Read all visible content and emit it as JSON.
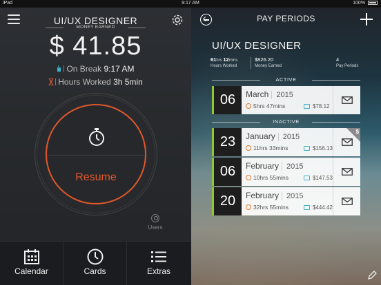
{
  "status_bar": {
    "device": "iPad",
    "time": "9:17 AM",
    "battery": "100%"
  },
  "left": {
    "job_title": "UI/UX DESIGNER",
    "earned_label": "MONEY EARNED",
    "earned_amount": "$ 41.85",
    "break_label": "On Break",
    "break_time": "9:17 AM",
    "hours_label": "Hours Worked",
    "hours_value": "3h 5min",
    "resume_label": "Resume",
    "users_label": "Users",
    "accent_color": "#e2582a"
  },
  "tabs": [
    {
      "label": "Calendar",
      "icon": "calendar-icon"
    },
    {
      "label": "Cards",
      "icon": "clock-icon"
    },
    {
      "label": "Extras",
      "icon": "list-icon"
    }
  ],
  "right": {
    "title": "PAY PERIODS",
    "job_name": "UI/UX DESIGNER",
    "summary": {
      "hours_h": "61",
      "hours_h_unit": "hrs",
      "hours_m": "12",
      "hours_m_unit": "mins",
      "hours_label": "Hours Worked",
      "money": "$826.20",
      "money_label": "Money Earned",
      "periods": "4",
      "periods_label": "Pay Periods"
    },
    "active_label": "ACTIVE",
    "inactive_label": "INACTIVE",
    "active": [
      {
        "day": "06",
        "month": "March",
        "year": "2015",
        "hours": "5hrs 47mins",
        "pay": "$78.12",
        "paid": false
      }
    ],
    "inactive": [
      {
        "day": "23",
        "month": "January",
        "year": "2015",
        "hours": "11hrs 33mins",
        "pay": "$156.13",
        "paid": true,
        "badge": "$"
      },
      {
        "day": "06",
        "month": "February",
        "year": "2015",
        "hours": "10hrs 55mins",
        "pay": "$147.53",
        "paid": false
      },
      {
        "day": "20",
        "month": "February",
        "year": "2015",
        "hours": "32hrs 55mins",
        "pay": "$444.42",
        "paid": false
      }
    ],
    "accent_color": "#8cc83a"
  }
}
